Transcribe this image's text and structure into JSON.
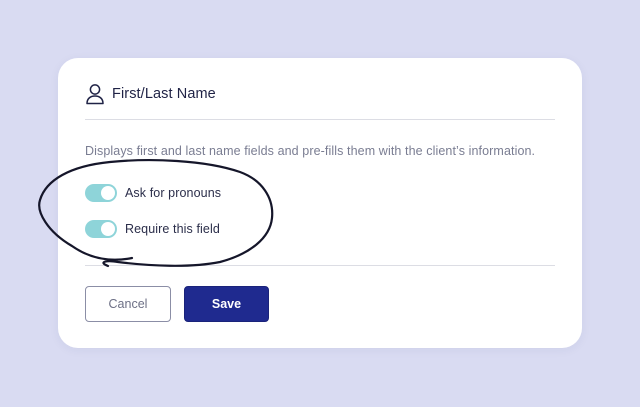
{
  "colors": {
    "background": "#d9dbf2",
    "card": "#ffffff",
    "toggle_on": "#8ed4d9",
    "primary_button": "#1f2a8f",
    "annotation_ink": "#15162a"
  },
  "field": {
    "icon": "user-icon",
    "title": "First/Last Name",
    "description": "Displays first and last name fields and pre-fills them with the client’s information."
  },
  "toggles": [
    {
      "label": "Ask for pronouns",
      "enabled": true
    },
    {
      "label": "Require this field",
      "enabled": true
    }
  ],
  "buttons": {
    "cancel_label": "Cancel",
    "save_label": "Save"
  }
}
